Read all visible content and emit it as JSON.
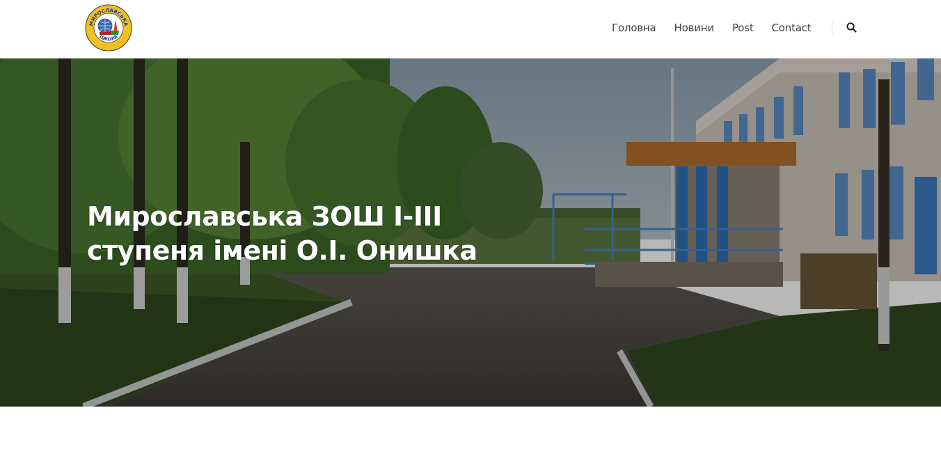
{
  "header": {
    "logo": {
      "arc_top": "МИРОСЛАВСЬКА",
      "arc_bottom": "ШКОЛА"
    },
    "nav": [
      {
        "label": "Головна"
      },
      {
        "label": "Новини"
      },
      {
        "label": "Post"
      },
      {
        "label": "Contact"
      }
    ],
    "search_icon": "search-icon"
  },
  "hero": {
    "title_line1": "Мирославська ЗОШ І-ІІІ",
    "title_line2": "ступеня імені О.І. Онишка"
  },
  "colors": {
    "nav_text": "#444444",
    "hero_title": "#ffffff",
    "logo_ring": "#f2c01e"
  }
}
